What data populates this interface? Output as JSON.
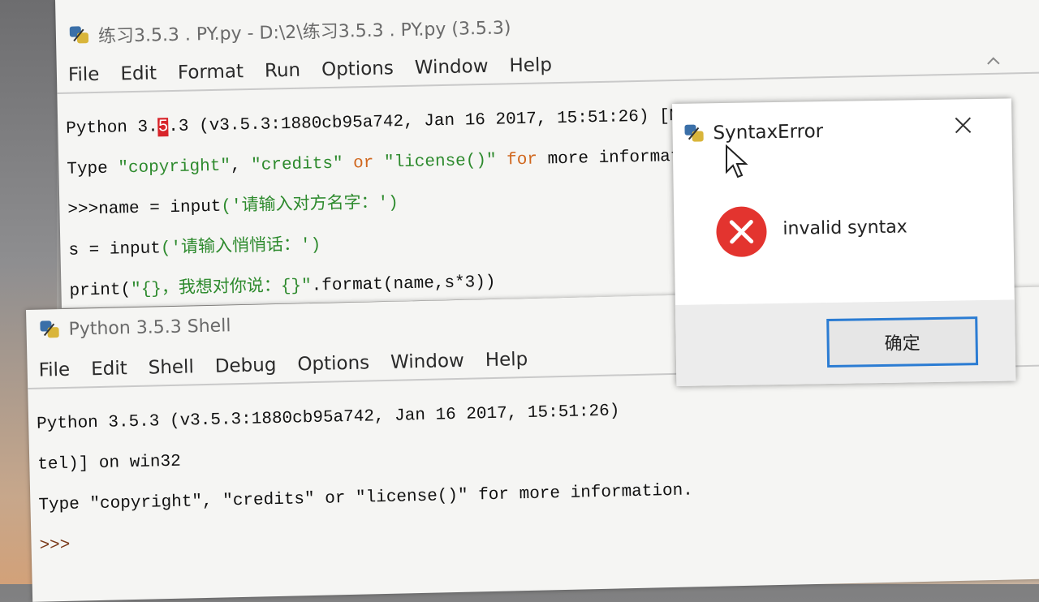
{
  "editor": {
    "title": "练习3.5.3 . PY.py - D:\\2\\练习3.5.3 . PY.py (3.5.3)",
    "menu": [
      "File",
      "Edit",
      "Format",
      "Run",
      "Options",
      "Window",
      "Help"
    ],
    "lines": {
      "l1_a": "Python 3.",
      "l1_cursor": "5",
      "l1_b": ".3 (v3.5.3:1880cb95a742, Jan 16 2017, 15:51:26) [MSC v.1900 32 bit (In",
      "l2_a": "Type ",
      "l2_s1": "\"copyright\"",
      "l2_b": ", ",
      "l2_s2": "\"credits\"",
      "l2_kw": " or ",
      "l2_s3": "\"license()\"",
      "l2_kw2": " for",
      "l2_c": " more information.",
      "l3_a": ">>>name = ",
      "l3_fn": "input",
      "l3_str": "('请输入对方名字：')",
      "l4_a": "s = ",
      "l4_fn": "input",
      "l4_str": "('请输入悄悄话：')",
      "l5_fn": "print",
      "l5_a": "(",
      "l5_str": "\"{}，我想对你说：{}\"",
      "l5_b": ".format(name,s*3))"
    }
  },
  "shell": {
    "title": "Python 3.5.3 Shell",
    "menu": [
      "File",
      "Edit",
      "Shell",
      "Debug",
      "Options",
      "Window",
      "Help"
    ],
    "line1": "Python 3.5.3 (v3.5.3:1880cb95a742, Jan 16 2017, 15:51:26)",
    "line2": "tel)] on win32",
    "line3": "Type \"copyright\", \"credits\" or \"license()\" for more information.",
    "prompt": ">>>"
  },
  "dialog": {
    "title": "SyntaxError",
    "message": "invalid syntax",
    "ok_label": "确定",
    "icon": "error-icon"
  },
  "colors": {
    "error_red": "#e3342f",
    "focus_blue": "#2b7cd3",
    "string_green": "#2d8a2d",
    "keyword_orange": "#d0671e"
  }
}
